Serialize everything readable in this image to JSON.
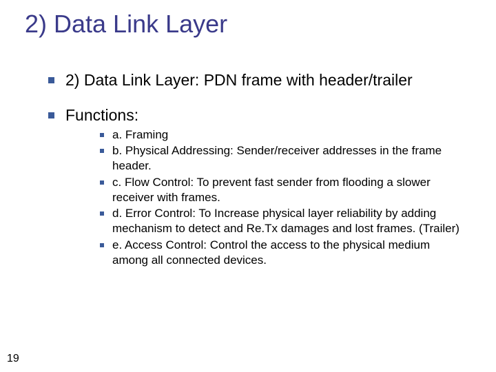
{
  "title": "2) Data Link Layer",
  "bullets": [
    {
      "text": "2) Data Link Layer: PDN frame with header/trailer"
    },
    {
      "text": "Functions:",
      "sub": [
        "a. Framing",
        "b. Physical Addressing: Sender/receiver addresses in the frame header.",
        "c. Flow Control: To prevent fast sender from flooding a slower receiver with frames.",
        "d. Error Control: To Increase physical layer reliability by adding mechanism to detect and Re.Tx damages and lost frames. (Trailer)",
        "e. Access Control: Control the access to the physical medium among all connected devices."
      ]
    }
  ],
  "page_number": "19"
}
